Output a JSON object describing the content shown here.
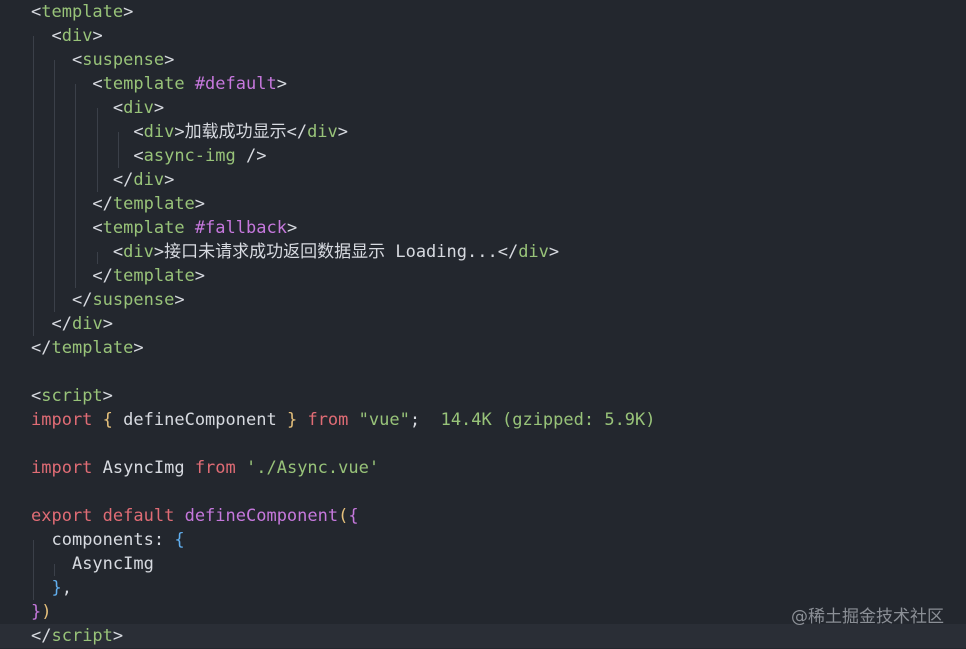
{
  "code": {
    "l1": {
      "open": "<",
      "tag": "template",
      "close": ">"
    },
    "l2": {
      "open": "<",
      "tag": "div",
      "close": ">"
    },
    "l3": {
      "open": "<",
      "tag": "suspense",
      "close": ">"
    },
    "l4": {
      "open": "<",
      "tag": "template",
      "attr": "#default",
      "close": ">"
    },
    "l5": {
      "open": "<",
      "tag": "div",
      "close": ">"
    },
    "l6": {
      "open": "<",
      "tag": "div",
      "close": ">",
      "text": "加载成功显示",
      "eopen": "</",
      "etag": "div",
      "eclose": ">"
    },
    "l7": {
      "open": "<",
      "tag": "async-img",
      "close": " />"
    },
    "l8": {
      "open": "</",
      "tag": "div",
      "close": ">"
    },
    "l9": {
      "open": "</",
      "tag": "template",
      "close": ">"
    },
    "l10": {
      "open": "<",
      "tag": "template",
      "attr": "#fallback",
      "close": ">"
    },
    "l11": {
      "open": "<",
      "tag": "div",
      "close": ">",
      "text": "接口未请求成功返回数据显示 Loading...",
      "eopen": "</",
      "etag": "div",
      "eclose": ">"
    },
    "l12": {
      "open": "</",
      "tag": "template",
      "close": ">"
    },
    "l13": {
      "open": "</",
      "tag": "suspense",
      "close": ">"
    },
    "l14": {
      "open": "</",
      "tag": "div",
      "close": ">"
    },
    "l15": {
      "open": "</",
      "tag": "template",
      "close": ">"
    },
    "l17": {
      "open": "<",
      "tag": "script",
      "close": ">"
    },
    "l18": {
      "kw": "import",
      "lb": "{",
      "ident": "defineComponent",
      "rb": "}",
      "from": "from",
      "str": "\"vue\"",
      "semi": ";",
      "size": "14.4K (gzipped: 5.9K)"
    },
    "l20": {
      "kw": "import",
      "ident": "AsyncImg",
      "from": "from",
      "str": "'./Async.vue'"
    },
    "l22": {
      "kw": "export",
      "kw2": "default",
      "fn": "defineComponent",
      "lp": "(",
      "lb": "{"
    },
    "l23": {
      "ident": "components:",
      "lb": "{"
    },
    "l24": {
      "ident": "AsyncImg"
    },
    "l25": {
      "rb": "}",
      "comma": ","
    },
    "l26": {
      "rb": "}",
      "rp": ")"
    },
    "l27": {
      "open": "</",
      "tag": "script",
      "close": ">"
    }
  },
  "watermark": "@稀土掘金技术社区",
  "colors": {
    "background": "#23272e",
    "tag": "#98c379",
    "attribute": "#c678dd",
    "keyword": "#e06c75",
    "string": "#98c379",
    "function": "#c678dd"
  }
}
